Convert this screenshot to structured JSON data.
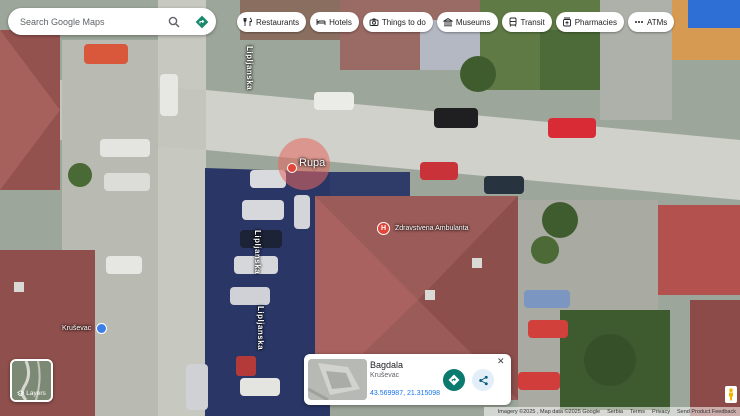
{
  "search": {
    "placeholder": "Search Google Maps"
  },
  "chips": [
    {
      "label": "Restaurants",
      "icon": "fork-knife-icon"
    },
    {
      "label": "Hotels",
      "icon": "bed-icon"
    },
    {
      "label": "Things to do",
      "icon": "camera-icon"
    },
    {
      "label": "Museums",
      "icon": "museum-icon"
    },
    {
      "label": "Transit",
      "icon": "train-icon"
    },
    {
      "label": "Pharmacies",
      "icon": "pharmacy-icon"
    },
    {
      "label": "ATMs",
      "icon": "more-dots-icon"
    }
  ],
  "map_labels": {
    "street_1": "Liplјanska",
    "street_2": "Liplјanska",
    "street_3": "Liplјanska",
    "place_rupa": "Rupa",
    "place_ambulanta": "Zdravstvena Ambulanta",
    "place_krusevac": "Kruševac",
    "hospital_marker": "H"
  },
  "card": {
    "title": "Bagdala",
    "subtitle": "Kruševac",
    "coords": "43.569987, 21.315098",
    "close_glyph": "✕"
  },
  "layers": {
    "label": "Layers"
  },
  "footer": {
    "imagery": "Imagery ©2025 , Map data ©2025 Google",
    "serbia": "Serbia",
    "terms": "Terms",
    "privacy": "Privacy",
    "feedback": "Send Product Feedback"
  },
  "colors": {
    "roof": "#9a5a58",
    "road": "#c9cbc4",
    "shadow": "#2b3a6a",
    "marker": "#e2463a",
    "accent": "#1a73e8"
  }
}
